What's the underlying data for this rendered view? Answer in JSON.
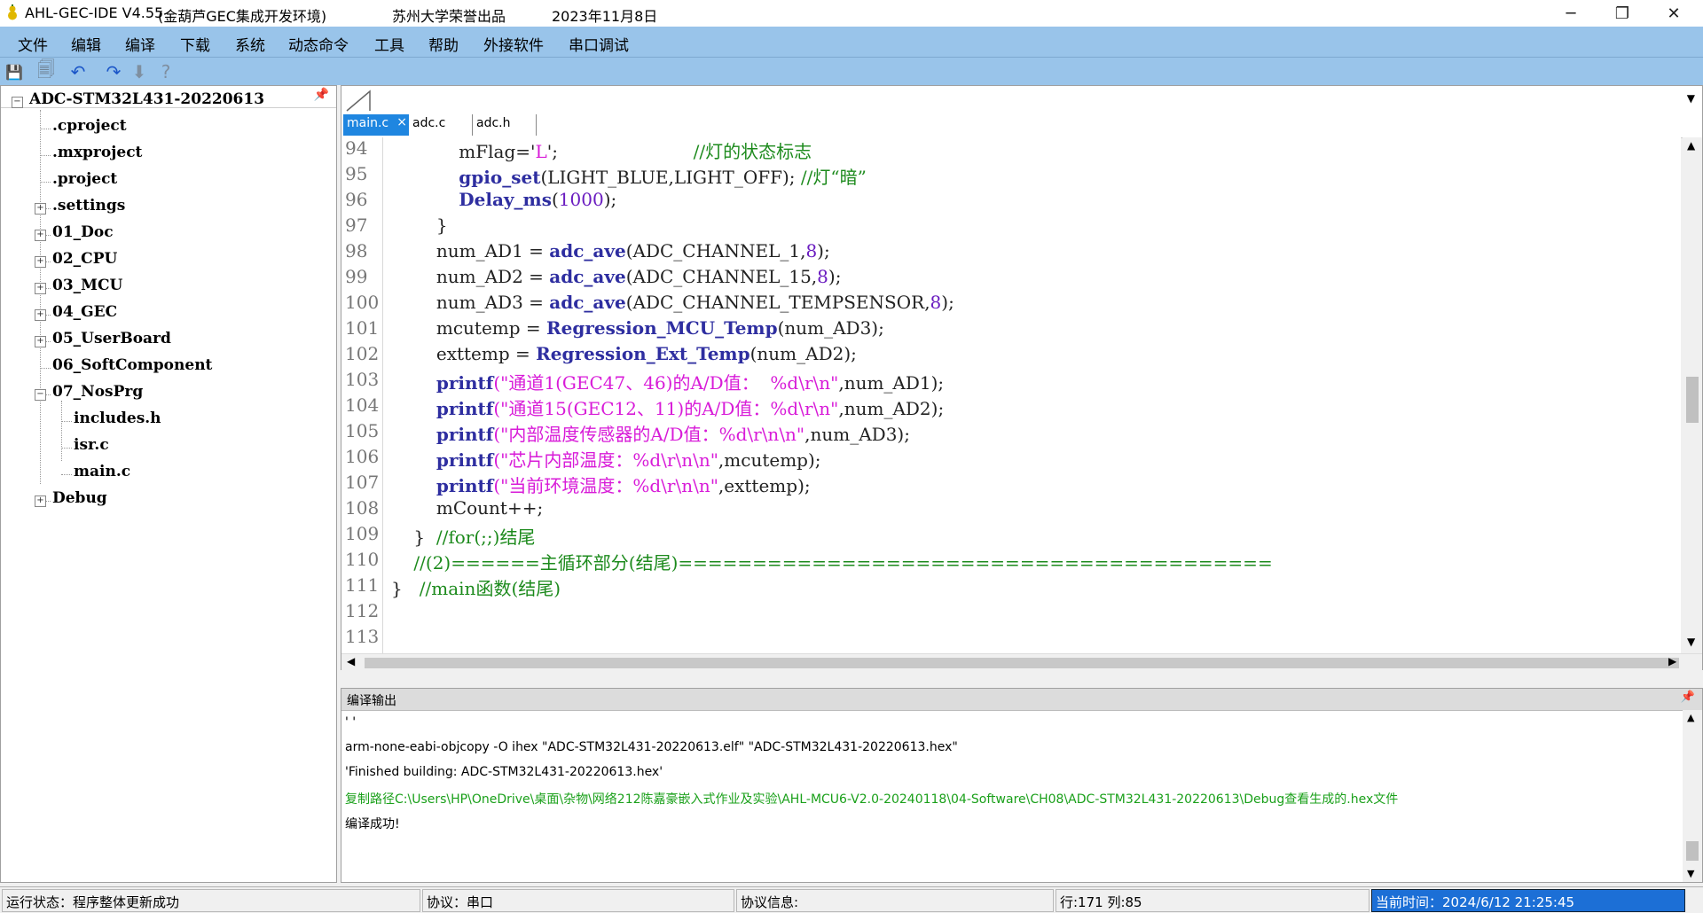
{
  "window": {
    "title": "AHL-GEC-IDE V4.55",
    "subtitle": "(金葫芦GEC集成开发环境)",
    "org": "苏州大学荣誉出品",
    "date": "2023年11月8日",
    "minimize_icon": "─",
    "maximize_icon": "❐",
    "close_icon": "✕"
  },
  "menu": [
    "文件",
    "编辑",
    "编译",
    "下载",
    "系统",
    "动态命令",
    "工具",
    "帮助",
    "外接软件",
    "串口调试"
  ],
  "toolbar": {
    "save_icon": "💾",
    "save_all_icon": "🗐",
    "undo_icon": "↶",
    "redo_icon": "↷",
    "down_icon": "⬇",
    "help_icon": "?"
  },
  "tree": {
    "root": "ADC-STM32L431-20220613",
    "pin_icon": "📌",
    "items": [
      {
        "label": ".cproject",
        "toggle": ""
      },
      {
        "label": ".mxproject",
        "toggle": ""
      },
      {
        "label": ".project",
        "toggle": ""
      },
      {
        "label": ".settings",
        "toggle": "+"
      },
      {
        "label": "01_Doc",
        "toggle": "+"
      },
      {
        "label": "02_CPU",
        "toggle": "+"
      },
      {
        "label": "03_MCU",
        "toggle": "+"
      },
      {
        "label": "04_GEC",
        "toggle": "+"
      },
      {
        "label": "05_UserBoard",
        "toggle": "+"
      },
      {
        "label": "06_SoftComponent",
        "toggle": ""
      },
      {
        "label": "07_NosPrg",
        "toggle": "−"
      },
      {
        "label": "includes.h",
        "toggle": "",
        "child": true
      },
      {
        "label": "isr.c",
        "toggle": "",
        "child": true
      },
      {
        "label": "main.c",
        "toggle": "",
        "child": true
      },
      {
        "label": "Debug",
        "toggle": "+"
      }
    ]
  },
  "editor": {
    "tabs": [
      "main.c",
      "adc.c",
      "adc.h"
    ],
    "tab_close": "×",
    "dropdown_icon": "▼",
    "lines": [
      {
        "n": "94",
        "code": [
          [
            "plain",
            "            mFlag='"
          ],
          [
            "str",
            "L"
          ],
          [
            "plain",
            "';                        "
          ],
          [
            "cmt",
            "//灯的状态标志"
          ]
        ]
      },
      {
        "n": "95",
        "code": [
          [
            "plain",
            "            "
          ],
          [
            "kw",
            "gpio_set"
          ],
          [
            "plain",
            "(LIGHT_BLUE,LIGHT_OFF); "
          ],
          [
            "cmt",
            "//灯“暗”"
          ]
        ]
      },
      {
        "n": "96",
        "code": [
          [
            "plain",
            "            "
          ],
          [
            "kw",
            "Delay_ms"
          ],
          [
            "plain",
            "("
          ],
          [
            "num",
            "1000"
          ],
          [
            "plain",
            ");"
          ]
        ]
      },
      {
        "n": "97",
        "code": [
          [
            "plain",
            "        }"
          ]
        ]
      },
      {
        "n": "98",
        "code": [
          [
            "plain",
            "        num_AD1 = "
          ],
          [
            "kw",
            "adc_ave"
          ],
          [
            "plain",
            "(ADC_CHANNEL_1,"
          ],
          [
            "num",
            "8"
          ],
          [
            "plain",
            ");"
          ]
        ]
      },
      {
        "n": "99",
        "code": [
          [
            "plain",
            "        num_AD2 = "
          ],
          [
            "kw",
            "adc_ave"
          ],
          [
            "plain",
            "(ADC_CHANNEL_15,"
          ],
          [
            "num",
            "8"
          ],
          [
            "plain",
            ");"
          ]
        ]
      },
      {
        "n": "100",
        "code": [
          [
            "plain",
            "        num_AD3 = "
          ],
          [
            "kw",
            "adc_ave"
          ],
          [
            "plain",
            "(ADC_CHANNEL_TEMPSENSOR,"
          ],
          [
            "num",
            "8"
          ],
          [
            "plain",
            ");"
          ]
        ]
      },
      {
        "n": "101",
        "code": [
          [
            "plain",
            "        mcutemp = "
          ],
          [
            "kw",
            "Regression_MCU_Temp"
          ],
          [
            "plain",
            "(num_AD3);"
          ]
        ]
      },
      {
        "n": "102",
        "code": [
          [
            "plain",
            "        exttemp = "
          ],
          [
            "kw",
            "Regression_Ext_Temp"
          ],
          [
            "plain",
            "(num_AD2);"
          ]
        ]
      },
      {
        "n": "103",
        "code": [
          [
            "plain",
            "        "
          ],
          [
            "kw",
            "printf"
          ],
          [
            "str",
            "(\"通道1(GEC47、46)的A/D值：  %d\\r\\n\""
          ],
          [
            "plain",
            ",num_AD1);"
          ]
        ]
      },
      {
        "n": "104",
        "code": [
          [
            "plain",
            "        "
          ],
          [
            "kw",
            "printf"
          ],
          [
            "str",
            "(\"通道15(GEC12、11)的A/D值：%d\\r\\n\""
          ],
          [
            "plain",
            ",num_AD2);"
          ]
        ]
      },
      {
        "n": "105",
        "code": [
          [
            "plain",
            "        "
          ],
          [
            "kw",
            "printf"
          ],
          [
            "str",
            "(\"内部温度传感器的A/D值：%d\\r\\n\\n\""
          ],
          [
            "plain",
            ",num_AD3);"
          ]
        ]
      },
      {
        "n": "106",
        "code": [
          [
            "plain",
            "        "
          ],
          [
            "kw",
            "printf"
          ],
          [
            "str",
            "(\"芯片内部温度：%d\\r\\n\\n\""
          ],
          [
            "plain",
            ",mcutemp);"
          ]
        ]
      },
      {
        "n": "107",
        "code": [
          [
            "plain",
            "        "
          ],
          [
            "kw",
            "printf"
          ],
          [
            "str",
            "(\"当前环境温度：%d\\r\\n\\n\""
          ],
          [
            "plain",
            ",exttemp);"
          ]
        ]
      },
      {
        "n": "108",
        "code": [
          [
            "plain",
            "        mCount++;"
          ]
        ]
      },
      {
        "n": "109",
        "code": [
          [
            "plain",
            "    }  "
          ],
          [
            "cmt",
            "//for(;;)结尾"
          ]
        ]
      },
      {
        "n": "110",
        "code": [
          [
            "cmt",
            "    //(2)======主循环部分(结尾)========================================"
          ]
        ]
      },
      {
        "n": "111",
        "code": [
          [
            "plain",
            "}   "
          ],
          [
            "cmt",
            "//main函数(结尾)"
          ]
        ]
      },
      {
        "n": "112",
        "code": []
      },
      {
        "n": "113",
        "code": []
      }
    ]
  },
  "output": {
    "title": "编译输出",
    "pin_icon": "📌",
    "lines": [
      {
        "text": "' '",
        "color": "#000000"
      },
      {
        "text": "arm-none-eabi-objcopy -O ihex \"ADC-STM32L431-20220613.elf\"  \"ADC-STM32L431-20220613.hex\"",
        "color": "#000000"
      },
      {
        "text": "'Finished building: ADC-STM32L431-20220613.hex'",
        "color": "#000000"
      },
      {
        "text": "复制路径C:\\Users\\HP\\OneDrive\\桌面\\杂物\\网络212陈嘉豪嵌入式作业及实验\\AHL-MCU6-V2.0-20240118\\04-Software\\CH08\\ADC-STM32L431-20220613\\Debug查看生成的.hex文件",
        "color": "#1aa01a"
      },
      {
        "text": "编译成功!",
        "color": "#000000"
      }
    ]
  },
  "status": {
    "run_state": "运行状态：程序整体更新成功",
    "protocol": "协议：串口",
    "protocol_info": "协议信息:",
    "position": "行:171 列:85",
    "time": "当前时间：2024/6/12 21:25:45"
  }
}
